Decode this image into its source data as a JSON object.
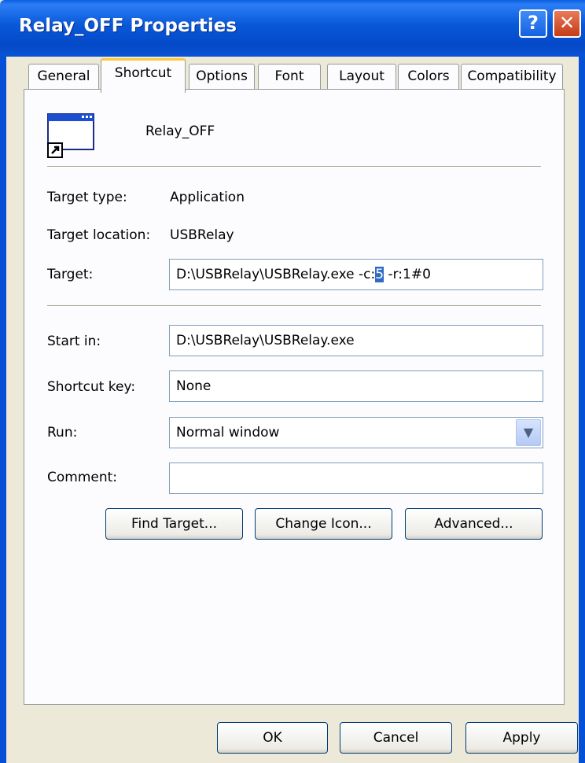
{
  "window": {
    "title": "Relay_OFF Properties",
    "help_glyph": "?",
    "close_glyph": "✕"
  },
  "tabs": [
    {
      "label": "General"
    },
    {
      "label": "Shortcut"
    },
    {
      "label": "Options"
    },
    {
      "label": "Font"
    },
    {
      "label": "Layout"
    },
    {
      "label": "Colors"
    },
    {
      "label": "Compatibility"
    }
  ],
  "active_tab": "Shortcut",
  "shortcut": {
    "name": "Relay_OFF",
    "target_type_label": "Target type:",
    "target_type_value": "Application",
    "target_location_label": "Target location:",
    "target_location_value": "USBRelay",
    "target_label": "Target:",
    "target_value_before": "D:\\USBRelay\\USBRelay.exe -c:",
    "target_value_selected": "5",
    "target_value_after": " -r:1#0",
    "start_in_label": "Start in:",
    "start_in_value": "D:\\USBRelay\\USBRelay.exe",
    "shortcut_key_label": "Shortcut key:",
    "shortcut_key_value": "None",
    "run_label": "Run:",
    "run_value": "Normal window",
    "comment_label": "Comment:",
    "comment_value": "",
    "find_target": "Find Target...",
    "change_icon": "Change Icon...",
    "advanced": "Advanced..."
  },
  "footer": {
    "ok": "OK",
    "cancel": "Cancel",
    "apply": "Apply"
  },
  "icons": {
    "help": "help-icon",
    "close": "close-icon",
    "shortcut": "shortcut-app-icon",
    "dropdown": "chevron-down-icon"
  },
  "colors": {
    "titlebar": "#0a54d4",
    "dialog_bg": "#ece9d8",
    "selection": "#316ac5",
    "close_btn": "#c53b17"
  }
}
